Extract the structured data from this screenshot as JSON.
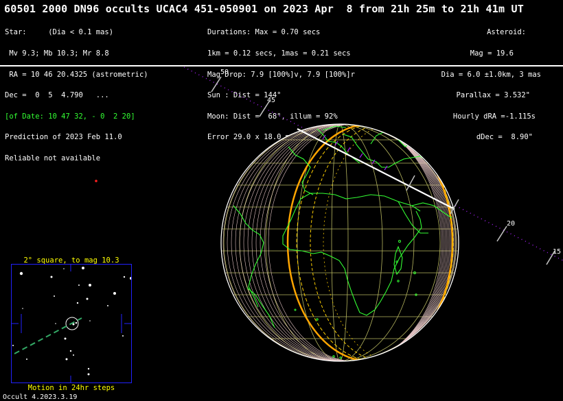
{
  "title": "60501 2000 DN96 occults UCAC4 451-050901 on 2023 Apr  8 from 21h 25m to 21h 41m UT",
  "star": [
    "Star:     (Dia < 0.1 mas)",
    " Mv 9.3; Mb 10.3; Mr 8.8",
    " RA = 10 46 20.4325 (astrometric)",
    "Dec =  0  5  4.790   ...",
    "[of Date: 10 47 32, - 0  2 20]",
    "Prediction of 2023 Feb 11.0",
    "Reliable not available"
  ],
  "durations": [
    "Durations: Max = 0.70 secs",
    "1km = 0.12 secs, 1mas = 0.21 secs",
    "Mag Drop: 7.9 [100%]v, 7.9 [100%]r",
    "Sun : Dist = 144°",
    "Moon: Dist =  68°, illum = 92%",
    "Error 29.0 x 18.0 mas in PA 117°"
  ],
  "asteroid": [
    "Asteroid:",
    "Mag = 19.6",
    "Dia = 6.0 ±1.0km, 3 mas",
    "Parallax = 3.532\"",
    "Hourly dRA =-1.115s",
    "dDec =  8.90\""
  ],
  "track_labels": [
    "50",
    "45",
    "20",
    "15"
  ],
  "finder": {
    "title": "2° square, to mag 10.3",
    "caption": "Motion in 24hr steps"
  },
  "footer": "Occult 4.2023.3.19",
  "colors": {
    "coast": "#33ff33",
    "grid": "#b8b860",
    "limb": "#ffffff",
    "track": "#a020f0",
    "path_edge": "#ffa500",
    "finder_frame": "#2222ff",
    "finder_text": "#ffff00"
  }
}
